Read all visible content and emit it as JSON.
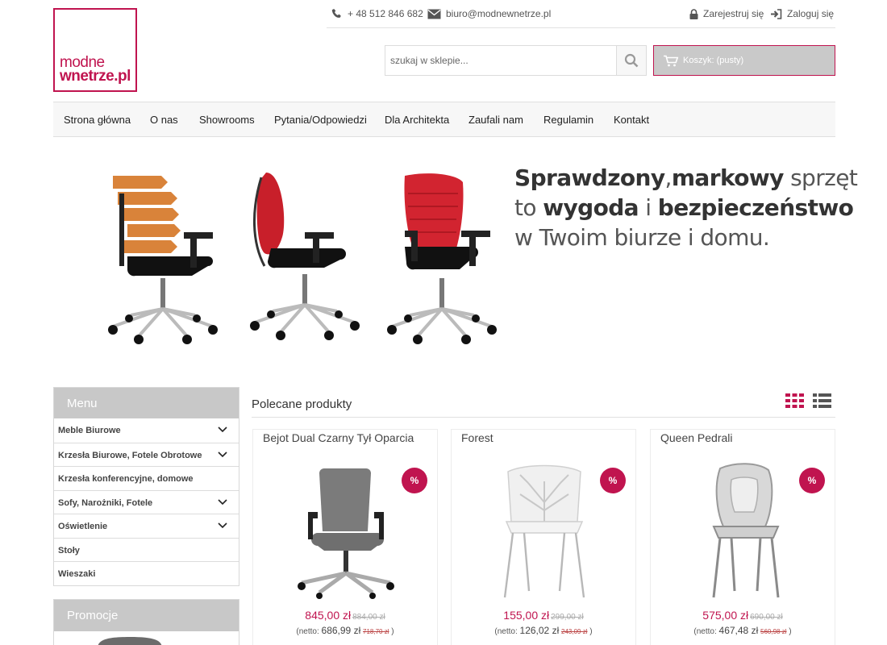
{
  "logo": {
    "line1": "modne",
    "line2": "wnetrze.pl"
  },
  "topbar": {
    "phone": "+ 48 512 846 682",
    "email": "biuro@modnewnetrze.pl",
    "register": "Zarejestruj się",
    "login": "Zaloguj się"
  },
  "search": {
    "placeholder": "szukaj w sklepie..."
  },
  "cart": {
    "label": "Koszyk: (pusty)"
  },
  "nav": [
    "Strona główna",
    "O nas",
    "Showrooms",
    "Pytania/Odpowiedzi",
    "Dla Architekta",
    "Zaufali nam",
    "Regulamin",
    "Kontakt"
  ],
  "hero": {
    "l1a": "Sprawdzony",
    "l1b": ",",
    "l1c": "markowy",
    "l1d": " sprzęt",
    "l2a": "to ",
    "l2b": "wygoda",
    "l2c": " i ",
    "l2d": "bezpieczeństwo",
    "l3": "w Twoim biurze i domu."
  },
  "sidebar": {
    "menu_title": "Menu",
    "items": [
      {
        "label": "Meble Biurowe",
        "expandable": true
      },
      {
        "label": "Krzesła Biurowe, Fotele Obrotowe",
        "expandable": true
      },
      {
        "label": "Krzesła konferencyjne, domowe",
        "expandable": false
      },
      {
        "label": "Sofy, Narożniki, Fotele",
        "expandable": true
      },
      {
        "label": "Oświetlenie",
        "expandable": true
      },
      {
        "label": "Stoły",
        "expandable": false
      },
      {
        "label": "Wieszaki",
        "expandable": false
      }
    ],
    "promo_title": "Promocje"
  },
  "products": {
    "title": "Polecane produkty",
    "items": [
      {
        "name": "Bejot Dual Czarny Tył Oparcia",
        "badge": "%",
        "price": "845,00 zł",
        "old_price": "884,00 zł",
        "netto_label": "(netto:",
        "netto": "686,99 zł",
        "netto_old": "718,70 zł",
        "netto_close": ")"
      },
      {
        "name": "Forest",
        "badge": "%",
        "price": "155,00 zł",
        "old_price": "299,00 zł",
        "netto_label": "(netto:",
        "netto": "126,02 zł",
        "netto_old": "243,09 zł",
        "netto_close": ")"
      },
      {
        "name": "Queen Pedrali",
        "badge": "%",
        "price": "575,00 zł",
        "old_price": "690,00 zł",
        "netto_label": "(netto:",
        "netto": "467,48 zł",
        "netto_old": "560,98 zł",
        "netto_close": ")"
      }
    ]
  },
  "colors": {
    "accent": "#c0144f",
    "sidebar_header": "#c8c8c8",
    "cart_bg": "#c9c9c9"
  }
}
